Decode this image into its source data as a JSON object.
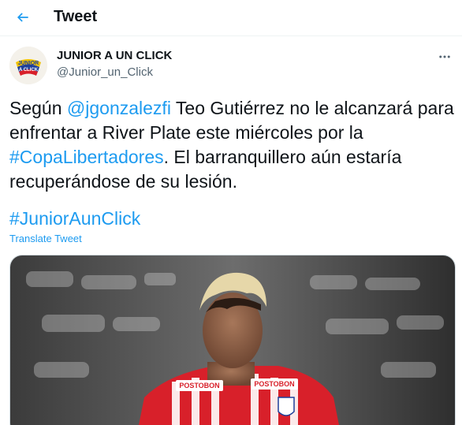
{
  "header": {
    "title": "Tweet"
  },
  "author": {
    "display_name": "JUNIOR A UN CLICK",
    "handle": "@Junior_un_Click",
    "avatar_text_top": "JUNIOR",
    "avatar_text_bottom": "A CLICK"
  },
  "tweet": {
    "text_before_mention": "Según ",
    "mention": "@jgonzalezfi",
    "text_middle": " Teo Gutiérrez no le alcanzará para enfrentar a River Plate este miércoles por la ",
    "hashtag_inline": "#CopaLibertadores",
    "text_after": ". El barranquillero aún estaría recuperándose de su lesión.",
    "hashtag_line": "#JuniorAunClick",
    "translate_label": "Translate Tweet"
  },
  "media": {
    "jersey_sponsor_left": "POSTOBON",
    "jersey_sponsor_right": "POSTOBON"
  },
  "colors": {
    "accent": "#1d9bf0",
    "text": "#0f1419",
    "secondary": "#536471",
    "jersey_red": "#d8202a"
  }
}
